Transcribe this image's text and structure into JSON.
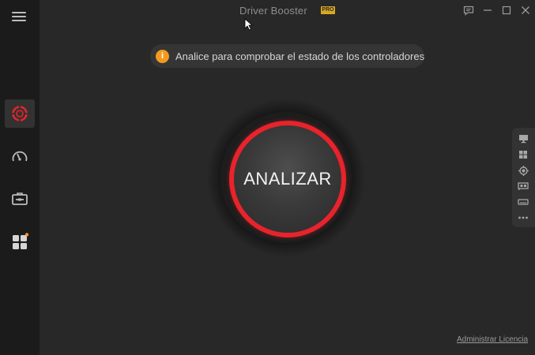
{
  "window": {
    "title": "Driver Booster",
    "badge": "PRO"
  },
  "sidebar": {
    "items": [
      {
        "icon": "lifebuoy-icon",
        "name": "driver-scan",
        "active": true
      },
      {
        "icon": "speedometer-icon",
        "name": "boost",
        "active": false
      },
      {
        "icon": "toolbox-icon",
        "name": "tools",
        "active": false
      },
      {
        "icon": "apps-grid-icon",
        "name": "action-center",
        "active": false,
        "has_dot": true
      }
    ]
  },
  "notice": {
    "icon": "info-icon",
    "icon_glyph": "i",
    "text": "Analice para comprobar el estado de los controladores"
  },
  "scan": {
    "label": "ANALIZAR"
  },
  "right_panel": {
    "items": [
      "monitor-icon",
      "windows-icon",
      "cpu-icon",
      "network-card-icon",
      "drive-icon",
      "more-icon"
    ]
  },
  "footer": {
    "license_link": "Administrar Licencia"
  },
  "colors": {
    "accent_red": "#e8232b",
    "notice_orange": "#f39a1e",
    "badge_gold": "#d8a821",
    "background": "#282828",
    "sidebar": "#1b1b1b"
  }
}
